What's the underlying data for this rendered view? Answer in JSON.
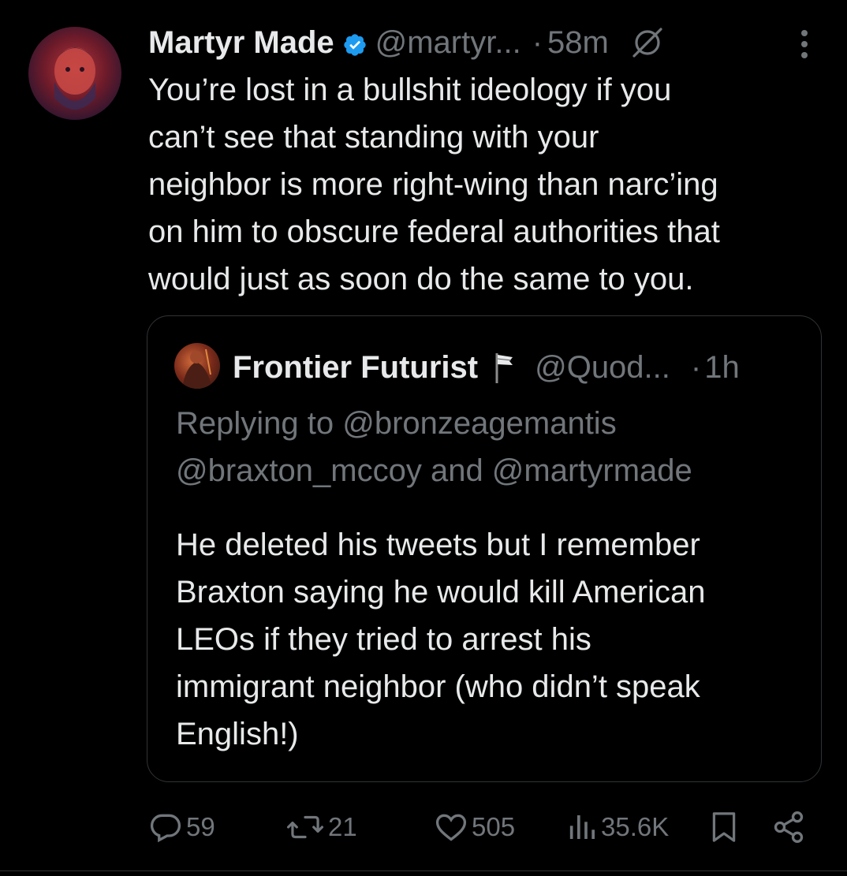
{
  "tweet": {
    "author_name": "Martyr Made",
    "handle": "@martyr...",
    "separator": "·",
    "time": "58m",
    "text": "You’re lost in a bullshit ideology if you\ncan’t see that standing with your\nneighbor is more right-wing than narc’ing\non him to obscure federal authorities that\nwould just as soon do the same to you."
  },
  "quote": {
    "author_name": "Frontier Futurist",
    "handle": "@Quod...",
    "separator": "·",
    "time": "1h",
    "replying_to": "Replying to @bronzeagemantis\n@braxton_mccoy and @martyrmade",
    "text": "He deleted his tweets but I remember\nBraxton saying he would kill American\nLEOs if they tried to arrest his\nimmigrant neighbor (who didn’t speak\nEnglish!)"
  },
  "actions": {
    "replies": "59",
    "reposts": "21",
    "likes": "505",
    "views": "35.6K"
  },
  "icons": {
    "verified": "verified-badge-icon",
    "grok": "grok-icon",
    "more": "more-vertical-icon",
    "flag": "flag-icon",
    "reply": "reply-icon",
    "repost": "repost-icon",
    "like": "heart-icon",
    "views": "views-chart-icon",
    "bookmark": "bookmark-icon",
    "share": "share-icon"
  },
  "colors": {
    "background": "#000000",
    "text": "#e7e9ea",
    "secondary": "#71767b",
    "verified": "#1d9bf0",
    "border": "#2f3336"
  }
}
